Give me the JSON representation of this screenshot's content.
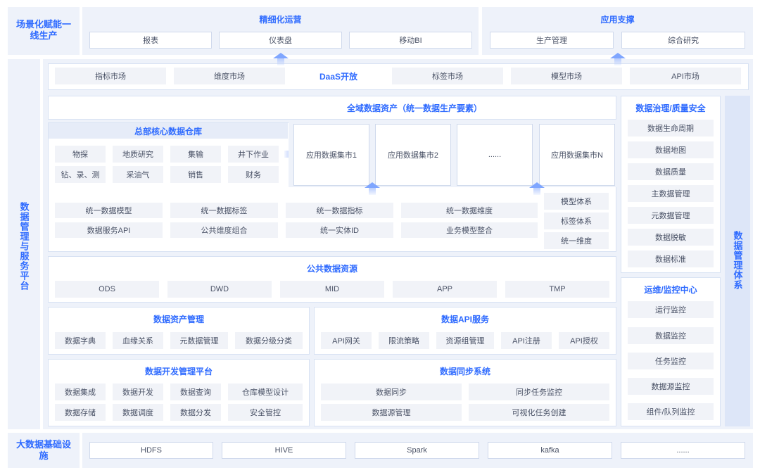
{
  "top": {
    "left_label": "场景化赋能一线生产",
    "ops": {
      "title": "精细化运营",
      "items": [
        "报表",
        "仪表盘",
        "移动BI"
      ]
    },
    "support": {
      "title": "应用支撑",
      "items": [
        "生产管理",
        "综合研究"
      ]
    }
  },
  "left_platform_label": "数据管理与服务平台",
  "right_system_label": "数据管理体系",
  "daas": {
    "title": "DaaS开放",
    "items": [
      "指标市场",
      "维度市场",
      "标签市场",
      "模型市场",
      "API市场"
    ]
  },
  "global_assets": {
    "title": "全域数据资产（统一数据生产要素）"
  },
  "core_dw": {
    "title": "总部核心数据仓库",
    "items": [
      "物探",
      "地质研究",
      "集输",
      "井下作业",
      "钻、录、测",
      "采油气",
      "销售",
      "财务"
    ]
  },
  "marts": [
    "应用数据集市1",
    "应用数据集市2",
    "......",
    "应用数据集市N"
  ],
  "unified": {
    "items": [
      "统一数据模型",
      "统一数据标签",
      "统一数据指标",
      "统一数据维度",
      "数据服务API",
      "公共维度组合",
      "统一实体ID",
      "业务模型整合"
    ],
    "side": [
      "模型体系",
      "标签体系",
      "统一维度"
    ]
  },
  "public_res": {
    "title": "公共数据资源",
    "items": [
      "ODS",
      "DWD",
      "MID",
      "APP",
      "TMP"
    ]
  },
  "asset_mgmt": {
    "title": "数据资产管理",
    "items": [
      "数据字典",
      "血缘关系",
      "元数据管理",
      "数据分级分类"
    ]
  },
  "api_service": {
    "title": "数据API服务",
    "items": [
      "API网关",
      "限流策略",
      "资源组管理",
      "API注册",
      "API授权"
    ]
  },
  "dev_platform": {
    "title": "数据开发管理平台",
    "items": [
      "数据集成",
      "数据开发",
      "数据查询",
      "仓库模型设计",
      "数据存储",
      "数据调度",
      "数据分发",
      "安全管控"
    ]
  },
  "sync_system": {
    "title": "数据同步系统",
    "items": [
      "数据同步",
      "同步任务监控",
      "数据源管理",
      "可视化任务创建"
    ]
  },
  "governance": {
    "title": "数据治理/质量安全",
    "items": [
      "数据生命周期",
      "数据地图",
      "数据质量",
      "主数据管理",
      "元数据管理",
      "数据脱敏",
      "数据标准"
    ]
  },
  "ops_center": {
    "title": "运维/监控中心",
    "items": [
      "运行监控",
      "数据监控",
      "任务监控",
      "数据源监控",
      "组件/队列监控"
    ]
  },
  "infra": {
    "label": "大数据基础设施",
    "items": [
      "HDFS",
      "HIVE",
      "Spark",
      "kafka",
      "......"
    ]
  },
  "colors": {
    "accent": "#2f6bff",
    "band": "#eef2fa",
    "chip": "#f1f3f8",
    "arrow": "#7fa6ff"
  }
}
